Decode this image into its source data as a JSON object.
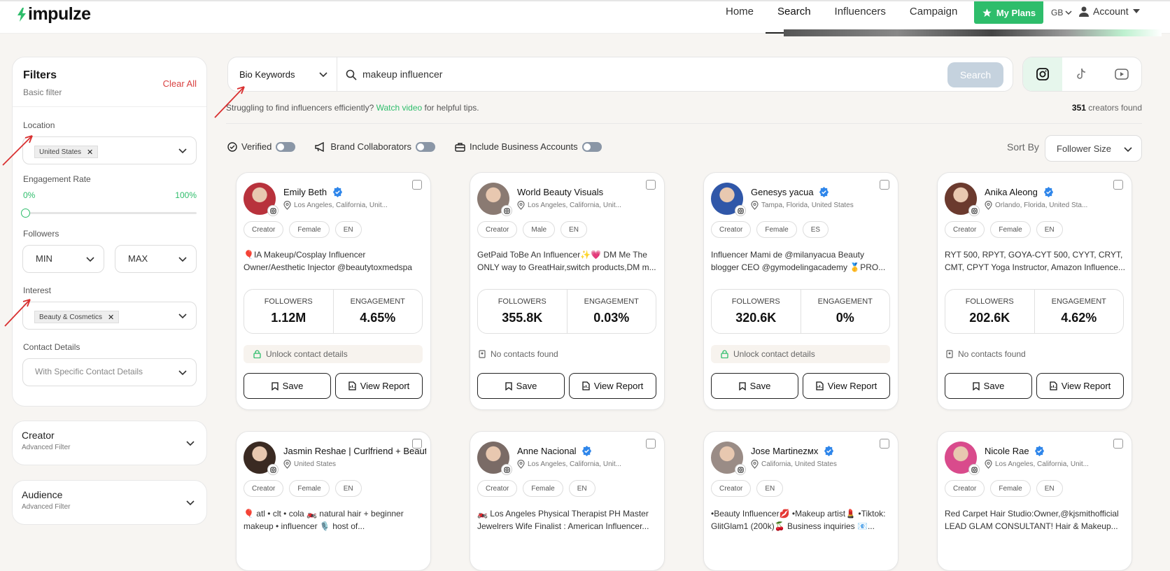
{
  "header": {
    "logo_text": "impulze",
    "nav": [
      "Home",
      "Search",
      "Influencers",
      "Campaign"
    ],
    "my_plans": "My Plans",
    "region": "GB",
    "account": "Account"
  },
  "filters": {
    "title": "Filters",
    "subtitle": "Basic filter",
    "clear_all": "Clear All",
    "location_label": "Location",
    "location_chip": "United States",
    "engagement_label": "Engagement Rate",
    "engagement_min": "0%",
    "engagement_max": "100%",
    "followers_label": "Followers",
    "followers_min": "MIN",
    "followers_max": "MAX",
    "interest_label": "Interest",
    "interest_chip": "Beauty & Cosmetics",
    "contact_label": "Contact Details",
    "contact_placeholder": "With Specific Contact Details",
    "creator_title": "Creator",
    "creator_sub": "Advanced Filter",
    "audience_title": "Audience",
    "audience_sub": "Advanced Filter"
  },
  "search": {
    "keyword_type": "Bio Keywords",
    "query": "makeup influencer",
    "button": "Search",
    "hint_prefix": "Struggling to find influencers efficiently?",
    "hint_link": "Watch video",
    "hint_suffix": "for helpful tips.",
    "count": "351",
    "count_suffix": "creators found"
  },
  "toggles": {
    "verified": "Verified",
    "brand": "Brand Collaborators",
    "business": "Include Business Accounts"
  },
  "sort": {
    "label": "Sort By",
    "value": "Follower Size"
  },
  "labels": {
    "followers": "FOLLOWERS",
    "engagement": "ENGAGEMENT",
    "save": "Save",
    "view_report": "View Report"
  },
  "cards": [
    {
      "name": "Emily Beth",
      "verified": true,
      "location": "Los Angeles, California, Unit...",
      "tags": [
        "Creator",
        "Female",
        "EN"
      ],
      "bio": "🎈IA Makeup/Cosplay Influencer Owner/Aesthetic Injector @beautytoxmedspa",
      "followers": "1.12M",
      "engagement": "4.65%",
      "contact": "Unlock contact details",
      "contact_type": "unlock",
      "avatar_color": "#b8323c"
    },
    {
      "name": "World Beauty Visuals",
      "verified": false,
      "location": "Los Angeles, California, Unit...",
      "tags": [
        "Creator",
        "Male",
        "EN"
      ],
      "bio": "GetPaid ToBe An Influencer✨💗 DM Me The ONLY way to GreatHair,switch products,DM m...",
      "followers": "355.8K",
      "engagement": "0.03%",
      "contact": "No contacts found",
      "contact_type": "plain",
      "avatar_color": "#8a7a72"
    },
    {
      "name": "Genesys yacua",
      "verified": true,
      "location": "Tampa, Florida, United States",
      "tags": [
        "Creator",
        "Female",
        "ES"
      ],
      "bio": "Influencer Mami de @milanyacua Beauty blogger CEO @gymodelingacademy 🥇PRO...",
      "followers": "320.6K",
      "engagement": "0%",
      "contact": "Unlock contact details",
      "contact_type": "unlock",
      "avatar_color": "#3057a8"
    },
    {
      "name": "Anika Aleong",
      "verified": true,
      "location": "Orlando, Florida, United Sta...",
      "tags": [
        "Creator",
        "Female",
        "EN"
      ],
      "bio": "RYT 500, RPYT, GOYA-CYT 500, CYYT, CRYT, CMT, CPYT Yoga Instructor, Amazon Influence...",
      "followers": "202.6K",
      "engagement": "4.62%",
      "contact": "No contacts found",
      "contact_type": "plain",
      "avatar_color": "#6b3a2e"
    },
    {
      "name": "Jasmin Reshae | Curlfriend + Beauty",
      "verified": false,
      "location": "United States",
      "tags": [
        "Creator",
        "Female",
        "EN"
      ],
      "bio": "🎈 atl • clt • cola 🏍️ natural hair + beginner makeup • influencer 🎙️ host of...",
      "avatar_color": "#3a2a22"
    },
    {
      "name": "Anne Nacional",
      "verified": true,
      "location": "Los Angeles, California, Unit...",
      "tags": [
        "Creator",
        "Female",
        "EN"
      ],
      "bio": "🏍️ Los Angeles Physical Therapist PH Master Jewelrers Wife Finalist : American Influencer...",
      "avatar_color": "#7a6b66"
    },
    {
      "name": "Jose Martinezмх",
      "verified": true,
      "location": "California, United States",
      "tags": [
        "Creator",
        "EN"
      ],
      "bio": "•Beauty Influencer💋 •Makeup artist💄 •Tiktok: GlitGlam1 (200k)🍒 Business inquiries 📧...",
      "avatar_color": "#9a8c86"
    },
    {
      "name": "Nicole Rae",
      "verified": true,
      "location": "Los Angeles, California, Unit...",
      "tags": [
        "Creator",
        "Female",
        "EN"
      ],
      "bio": "Red Carpet Hair Studio:Owner,@kjsmithofficial LEAD GLAM CONSULTANT! Hair & Makeup...",
      "avatar_color": "#d94b8c"
    }
  ],
  "colors": {
    "accent": "#2ebd6b",
    "danger": "#d94141",
    "arrow": "#d93030"
  }
}
